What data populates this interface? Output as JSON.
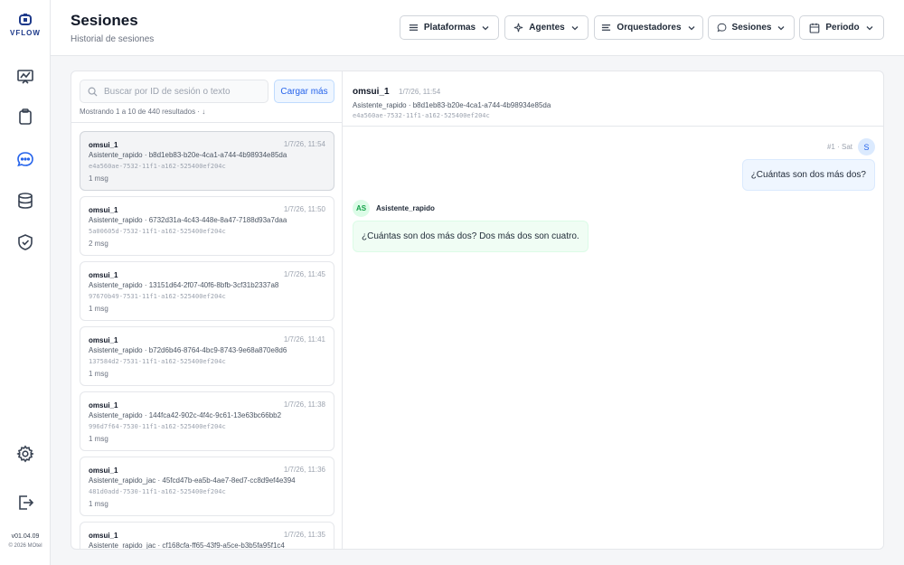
{
  "brand": {
    "name": "VFLOW"
  },
  "sidebar": {
    "icons": [
      "dashboard-icon",
      "clipboard-icon",
      "chat-icon",
      "database-icon",
      "shield-check-icon",
      "gear-icon",
      "logout-icon"
    ],
    "version": "v01.04.09",
    "copyright": "© 2026 MOtel"
  },
  "header": {
    "title": "Sesiones",
    "subtitle": "Historial de sesiones",
    "filters": [
      {
        "label": "Plataformas",
        "icon": "list-icon"
      },
      {
        "label": "Agentes",
        "icon": "sparkle-icon"
      },
      {
        "label": "Orquestadores",
        "icon": "list-icon"
      },
      {
        "label": "Sesiones",
        "icon": "chat-bubble-icon"
      },
      {
        "label": "Periodo",
        "icon": "calendar-icon"
      }
    ]
  },
  "search": {
    "placeholder": "Buscar por ID de sesión o texto",
    "value": ""
  },
  "load_more_label": "Cargar más",
  "results_info": "Mostrando 1 a 10 de 440 resultados · ↓",
  "sessions": [
    {
      "user": "omsui_1",
      "time": "1/7/26, 11:54",
      "agent": "Asistente_rapido · b8d1eb83-b20e-4ca1-a744-4b98934e85da",
      "id": "e4a560ae-7532-11f1-a162-525400ef204c",
      "count": "1 msg"
    },
    {
      "user": "omsui_1",
      "time": "1/7/26, 11:50",
      "agent": "Asistente_rapido · 6732d31a-4c43-448e-8a47-7188d93a7daa",
      "id": "5a00605d-7532-11f1-a162-525400ef204c",
      "count": "2 msg"
    },
    {
      "user": "omsui_1",
      "time": "1/7/26, 11:45",
      "agent": "Asistente_rapido · 13151d64-2f07-40f6-8bfb-3cf31b2337a8",
      "id": "97670b49-7531-11f1-a162-525400ef204c",
      "count": "1 msg"
    },
    {
      "user": "omsui_1",
      "time": "1/7/26, 11:41",
      "agent": "Asistente_rapido · b72d6b46-8764-4bc9-8743-9e68a870e8d6",
      "id": "137584d2-7531-11f1-a162-525400ef204c",
      "count": "1 msg"
    },
    {
      "user": "omsui_1",
      "time": "1/7/26, 11:38",
      "agent": "Asistente_rapido · 144fca42-902c-4f4c-9c61-13e63bc66bb2",
      "id": "996d7f64-7530-11f1-a162-525400ef204c",
      "count": "1 msg"
    },
    {
      "user": "omsui_1",
      "time": "1/7/26, 11:36",
      "agent": "Asistente_rapido_jac · 45fcd47b-ea5b-4ae7-8ed7-cc8d9ef4e394",
      "id": "481d0add-7530-11f1-a162-525400ef204c",
      "count": "1 msg"
    },
    {
      "user": "omsui_1",
      "time": "1/7/26, 11:35",
      "agent": "Asistente_rapido_jac · cf168cfa-ff65-43f9-a5ce-b3b5fa95f1c4",
      "id": "",
      "count": ""
    }
  ],
  "conversation": {
    "user": "omsui_1",
    "time": "1/7/26, 11:54",
    "agent": "Asistente_rapido · b8d1eb83-b20e-4ca1-a744-4b98934e85da",
    "id": "e4a560ae-7532-11f1-a162-525400ef204c",
    "user_msg_meta": "#1 · Sat",
    "user_avatar": "S",
    "user_message": "¿Cuántas son dos más dos?",
    "assistant_avatar": "AS",
    "assistant_name": "Asistente_rapido",
    "assistant_message": "¿Cuántas son dos más dos? Dos más dos son cuatro."
  }
}
